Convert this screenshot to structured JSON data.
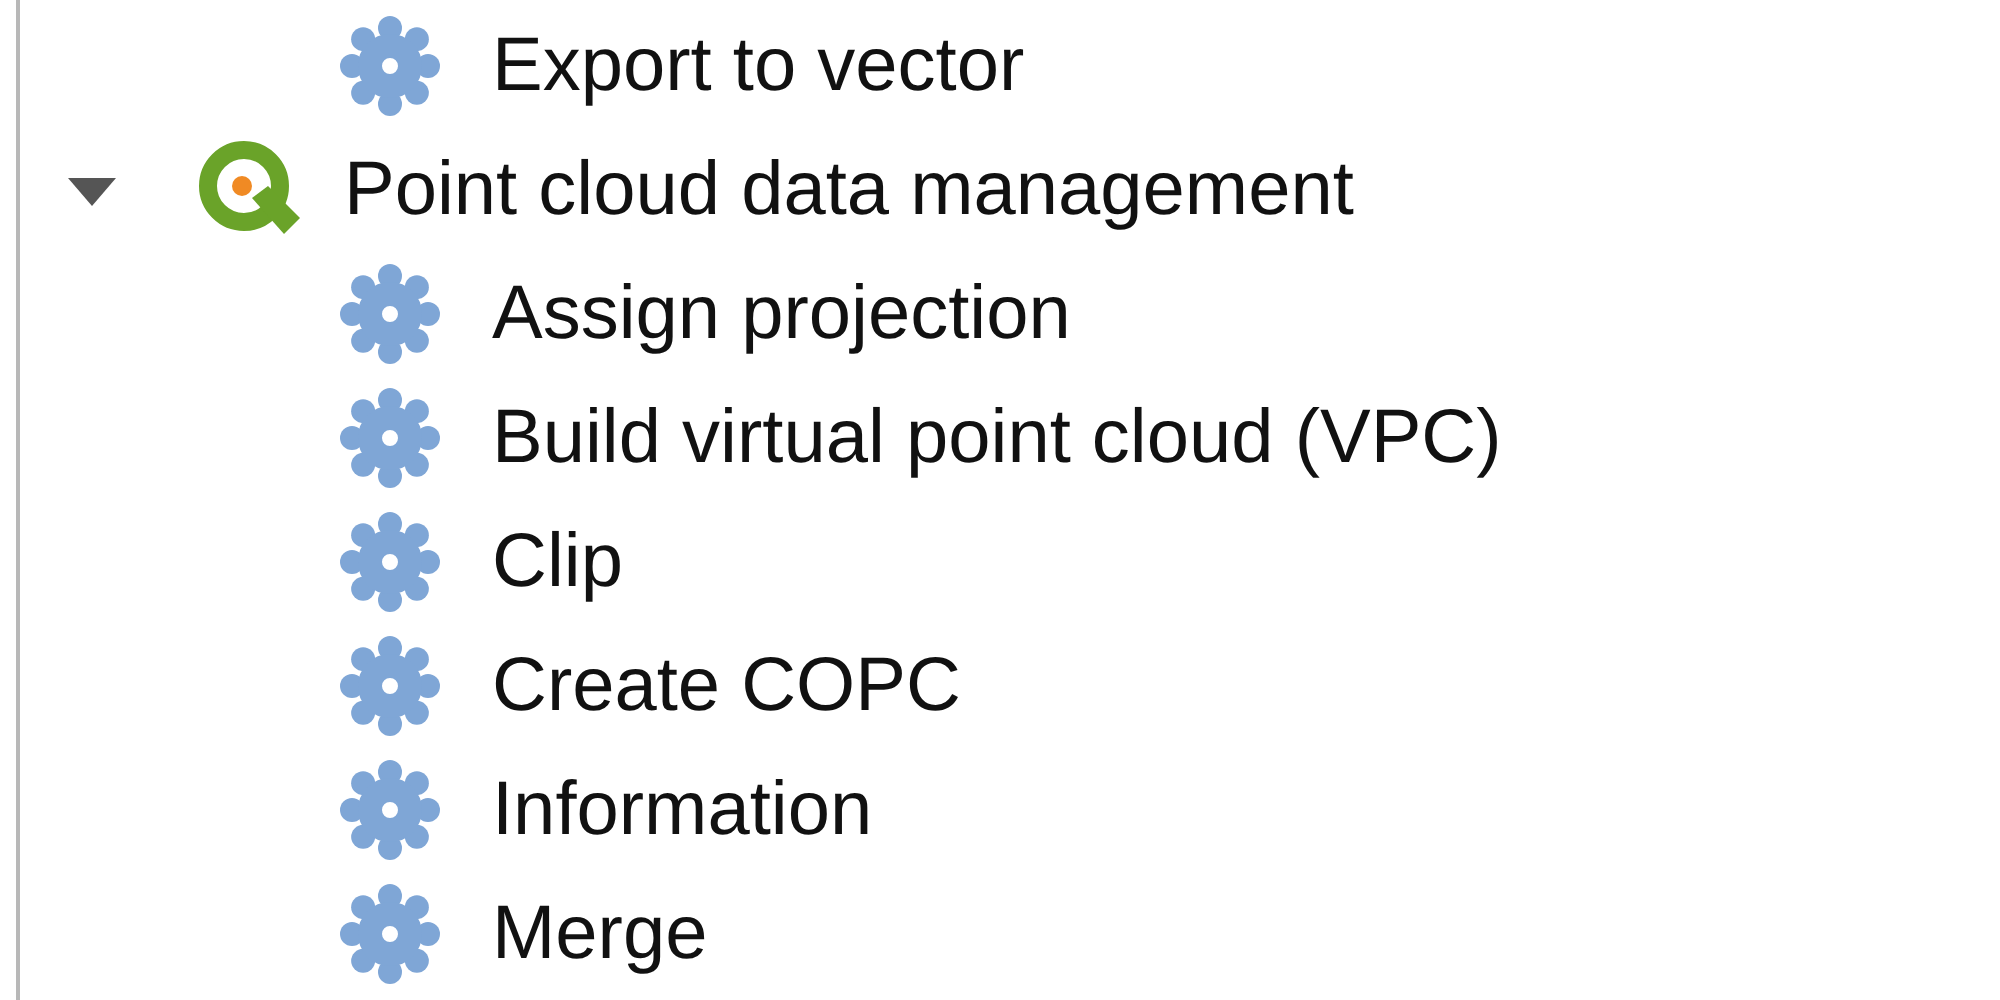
{
  "tree": [
    {
      "kind": "algorithm",
      "label": "Export to vector"
    },
    {
      "kind": "provider",
      "label": "Point cloud data management",
      "expanded": true,
      "children": [
        {
          "kind": "algorithm",
          "label": "Assign projection"
        },
        {
          "kind": "algorithm",
          "label": "Build virtual point cloud (VPC)"
        },
        {
          "kind": "algorithm",
          "label": "Clip"
        },
        {
          "kind": "algorithm",
          "label": "Create COPC"
        },
        {
          "kind": "algorithm",
          "label": "Information"
        },
        {
          "kind": "algorithm",
          "label": "Merge"
        }
      ]
    }
  ]
}
